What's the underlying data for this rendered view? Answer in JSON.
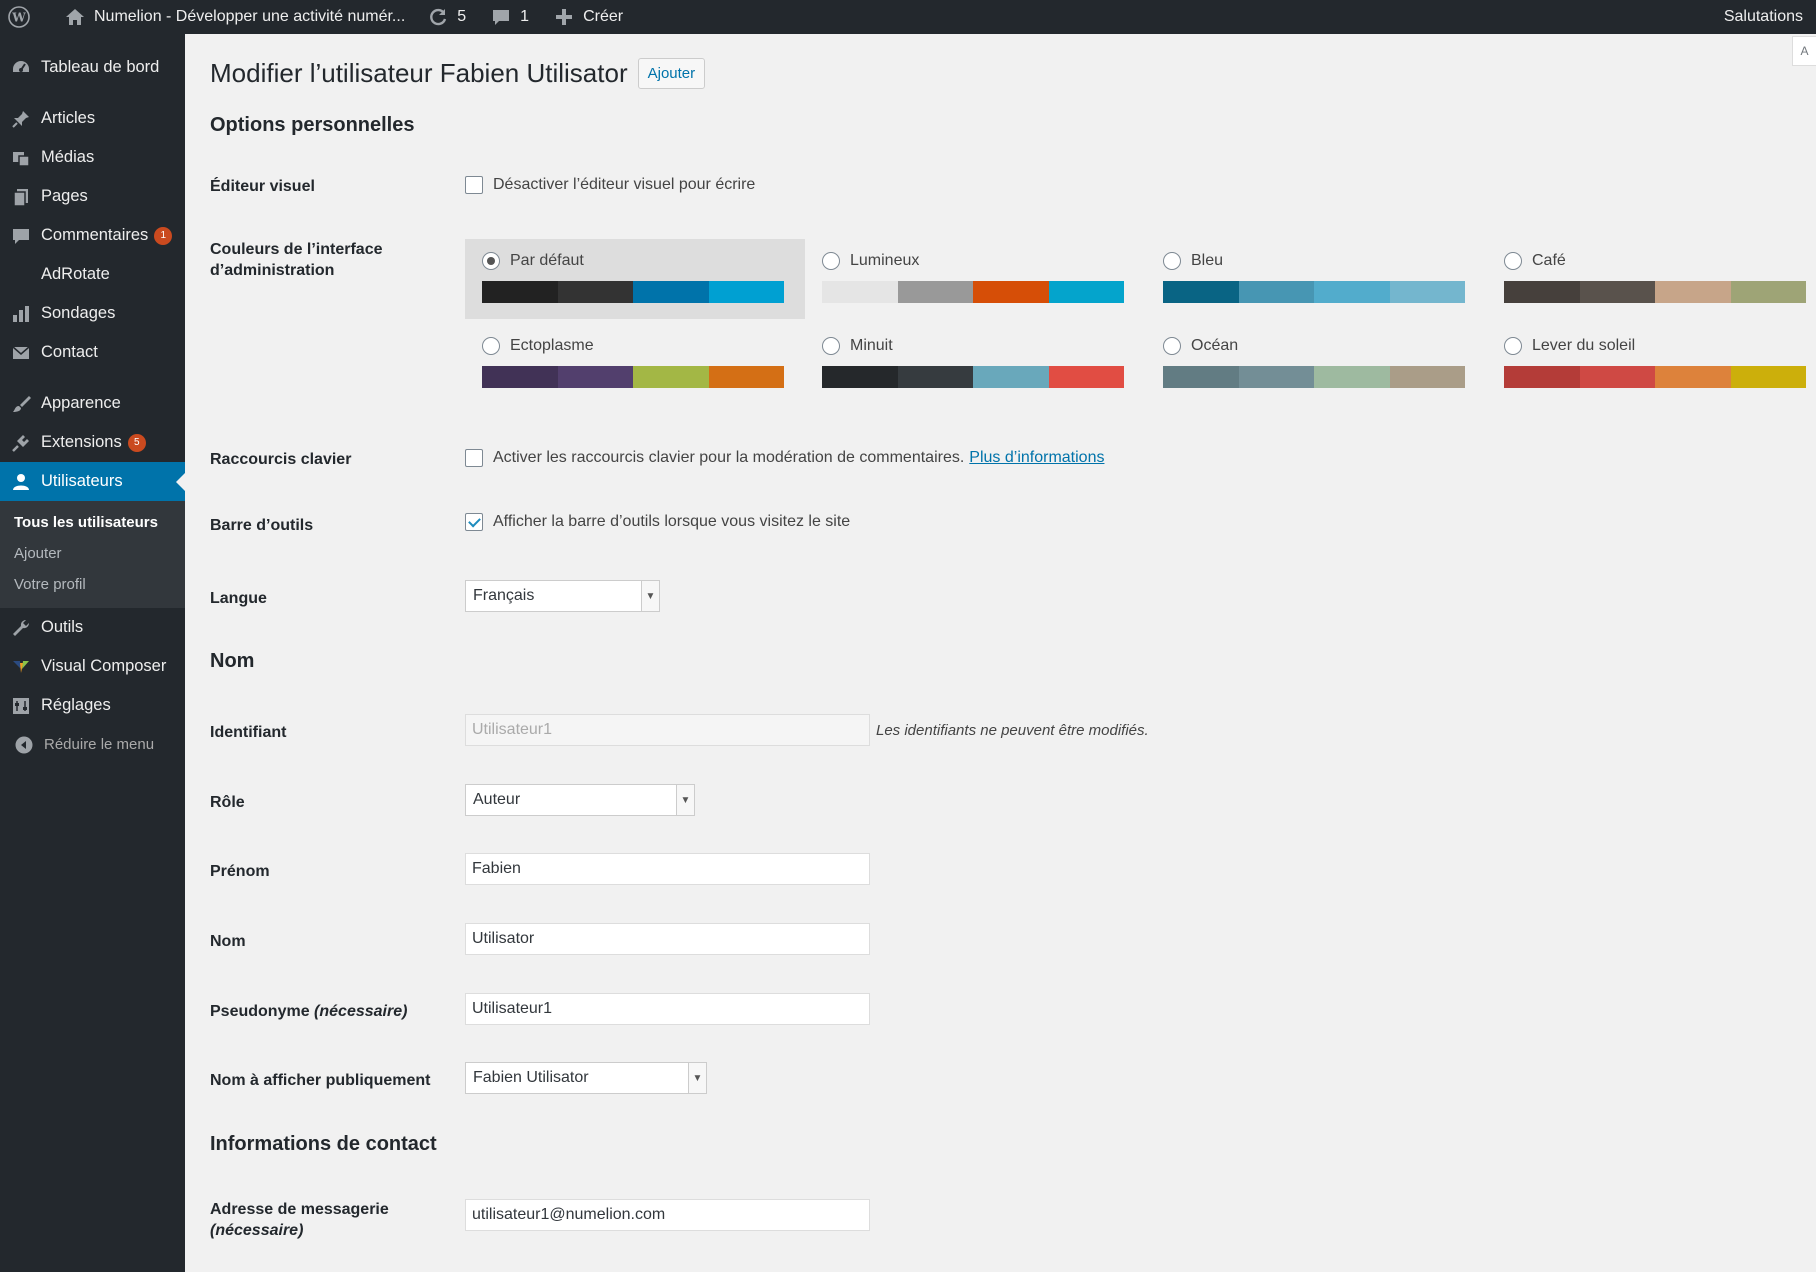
{
  "adminbar": {
    "site_name": "Numelion - Développer une activité numér...",
    "updates_count": "5",
    "comments_count": "1",
    "new_label": "Créer",
    "greeting": "Salutations",
    "screen_options_stub": "A"
  },
  "sidebar": {
    "items": [
      {
        "label": "Tableau de bord",
        "icon": "dashboard-icon"
      },
      {
        "label": "Articles",
        "icon": "pushpin-icon"
      },
      {
        "label": "Médias",
        "icon": "media-icon"
      },
      {
        "label": "Pages",
        "icon": "pages-icon"
      },
      {
        "label": "Commentaires",
        "icon": "comment-icon",
        "badge": "1"
      },
      {
        "label": "AdRotate",
        "icon": ""
      },
      {
        "label": "Sondages",
        "icon": "chart-bar-icon"
      },
      {
        "label": "Contact",
        "icon": "mail-icon"
      },
      {
        "label": "Apparence",
        "icon": "brush-icon"
      },
      {
        "label": "Extensions",
        "icon": "plugin-icon",
        "badge": "5"
      },
      {
        "label": "Utilisateurs",
        "icon": "user-icon"
      },
      {
        "label": "Outils",
        "icon": "wrench-icon"
      },
      {
        "label": "Visual Composer",
        "icon": "visual-composer-icon"
      },
      {
        "label": "Réglages",
        "icon": "settings-icon"
      }
    ],
    "submenu": [
      "Tous les utilisateurs",
      "Ajouter",
      "Votre profil"
    ],
    "collapse_label": "Réduire le menu"
  },
  "page": {
    "title": "Modifier l’utilisateur Fabien Utilisator",
    "add_button": "Ajouter"
  },
  "personal": {
    "section_title": "Options personnelles",
    "visual_editor": {
      "label": "Éditeur visuel",
      "text": "Désactiver l’éditeur visuel pour écrire",
      "checked": false
    },
    "color_label_line1": "Couleurs de l’interface",
    "color_label_line2": "d’administration",
    "schemes": [
      {
        "name": "Par défaut",
        "selected": true,
        "colors": [
          "#222222",
          "#333333",
          "#0073aa",
          "#00a0d2"
        ]
      },
      {
        "name": "Lumineux",
        "selected": false,
        "colors": [
          "#e5e5e5",
          "#999999",
          "#d64e07",
          "#04a4cc"
        ]
      },
      {
        "name": "Bleu",
        "selected": false,
        "colors": [
          "#096484",
          "#4796b3",
          "#52accc",
          "#74b6ce"
        ]
      },
      {
        "name": "Café",
        "selected": false,
        "colors": [
          "#46403c",
          "#59524c",
          "#c7a589",
          "#9ea476"
        ]
      },
      {
        "name": "Ectoplasme",
        "selected": false,
        "colors": [
          "#413256",
          "#523f6d",
          "#a3b745",
          "#d46f15"
        ]
      },
      {
        "name": "Minuit",
        "selected": false,
        "colors": [
          "#25282b",
          "#363b3f",
          "#69a8bb",
          "#e14d43"
        ]
      },
      {
        "name": "Océan",
        "selected": false,
        "colors": [
          "#627c83",
          "#738e96",
          "#9ebaa0",
          "#aa9d88"
        ]
      },
      {
        "name": "Lever du soleil",
        "selected": false,
        "colors": [
          "#b43c38",
          "#cf4944",
          "#dd823b",
          "#ccaf0b"
        ]
      }
    ],
    "shortcuts": {
      "label": "Raccourcis clavier",
      "text": "Activer les raccourcis clavier pour la modération de commentaires.",
      "link": "Plus d’informations",
      "checked": false
    },
    "toolbar": {
      "label": "Barre d’outils",
      "text": "Afficher la barre d’outils lorsque vous visitez le site",
      "checked": true
    },
    "language": {
      "label": "Langue",
      "value": "Français"
    }
  },
  "name": {
    "section_title": "Nom",
    "username": {
      "label": "Identifiant",
      "value": "Utilisateur1",
      "description": "Les identifiants ne peuvent être modifiés."
    },
    "role": {
      "label": "Rôle",
      "value": "Auteur"
    },
    "first_name": {
      "label": "Prénom",
      "value": "Fabien"
    },
    "last_name": {
      "label": "Nom",
      "value": "Utilisator"
    },
    "nickname": {
      "label": "Pseudonyme",
      "required": "(nécessaire)",
      "value": "Utilisateur1"
    },
    "display_name": {
      "label": "Nom à afficher publiquement",
      "value": "Fabien Utilisator"
    }
  },
  "contact": {
    "section_title": "Informations de contact",
    "email": {
      "label": "Adresse de messagerie",
      "required": "(nécessaire)",
      "value": "utilisateur1@numelion.com"
    }
  }
}
